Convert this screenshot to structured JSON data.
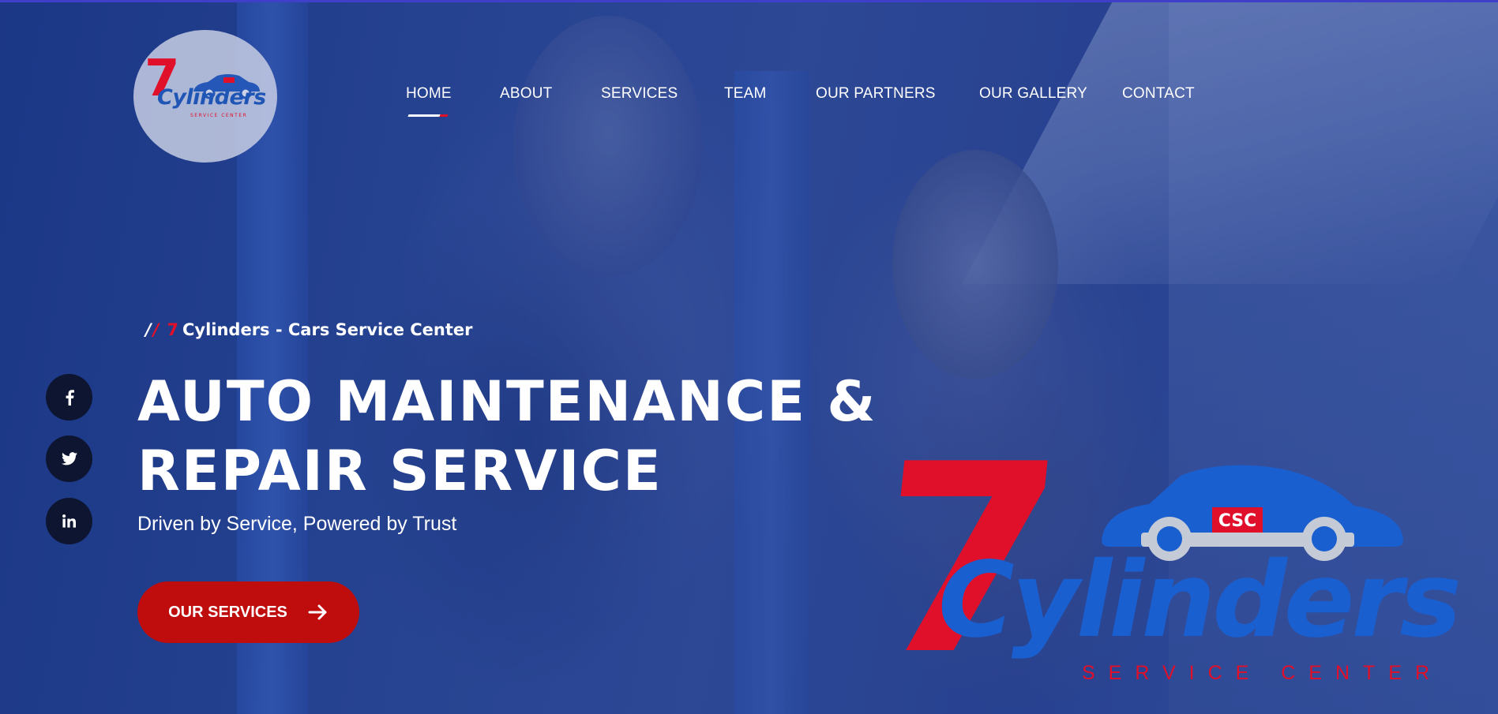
{
  "brand": {
    "logo_seven": "7",
    "logo_word": "Cylinders",
    "logo_sub": "SERVICE CENTER",
    "plate_text": "CSC"
  },
  "nav": {
    "items": [
      {
        "label": "HOME",
        "active": true
      },
      {
        "label": "ABOUT"
      },
      {
        "label": "SERVICES"
      },
      {
        "label": "TEAM"
      },
      {
        "label": "OUR PARTNERS"
      },
      {
        "label": "OUR GALLERY"
      },
      {
        "label": "CONTACT"
      }
    ]
  },
  "hero": {
    "tagline_seven": "7",
    "tagline_rest": "Cylinders - Cars Service Center",
    "headline_line1": "AUTO MAINTENANCE &",
    "headline_line2": "REPAIR SERVICE",
    "subheadline": "Driven by Service, Powered by Trust",
    "cta_label": "OUR SERVICES"
  },
  "social": [
    {
      "name": "facebook-icon"
    },
    {
      "name": "twitter-icon"
    },
    {
      "name": "linkedin-icon"
    }
  ],
  "colors": {
    "accent_red": "#e0102a",
    "cta_red": "#bf0d0d",
    "brand_blue": "#1a5fd0",
    "overlay_blue": "#1c3a86",
    "social_bg": "#0d1530"
  }
}
